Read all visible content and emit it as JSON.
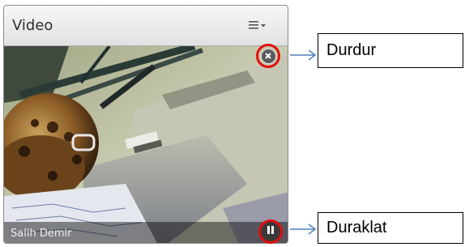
{
  "pod": {
    "title": "Video",
    "menu_icon": "menu-lines-icon"
  },
  "video": {
    "participant_name": "Salih Demir"
  },
  "controls": {
    "stop_icon": "close-circle-icon",
    "pause_icon": "pause-icon"
  },
  "callouts": {
    "stop_label": "Durdur",
    "pause_label": "Duraklat"
  },
  "colors": {
    "highlight_ring": "#e20d0d",
    "arrow": "#4f81bd"
  }
}
